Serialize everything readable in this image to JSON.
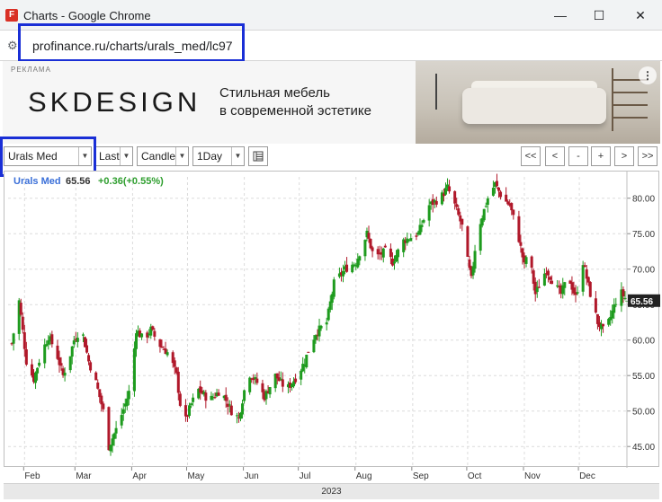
{
  "window": {
    "title": "Charts - Google Chrome",
    "app_icon_letter": "F",
    "minimize": "—",
    "maximize": "☐",
    "close": "✕"
  },
  "address": {
    "site_icon": "⚙",
    "url": "profinance.ru/charts/urals_med/lc97"
  },
  "ad": {
    "label": "РЕКЛАМА",
    "brand": "SKDESIGN",
    "line1": "Стильная мебель",
    "line2": "в современной эстетике",
    "menu_icon": "⋮"
  },
  "toolbar": {
    "symbol": "Urals Med",
    "price_type": "Last",
    "chart_type": "Candle",
    "interval": "1Day",
    "nav": [
      "<<",
      "<",
      "-",
      "+",
      ">",
      ">>"
    ]
  },
  "quote": {
    "name": "Urals Med",
    "last": "65.56",
    "change": "+0.36(+0.55%)"
  },
  "colors": {
    "up": "#1e9b1e",
    "down": "#b0182a",
    "name": "#3a6fd8",
    "change": "#2e9e2e",
    "highlight": "#1a2fd6"
  },
  "chart_data": {
    "type": "candlestick",
    "title": "",
    "ylim": [
      43,
      83
    ],
    "y_ticks": [
      "45.00",
      "50.00",
      "55.00",
      "60.00",
      "65.00",
      "70.00",
      "75.00",
      "80.00"
    ],
    "x_ticks": [
      "Feb",
      "Mar",
      "Apr",
      "May",
      "Jun",
      "Jul",
      "Aug",
      "Sep",
      "Oct",
      "Nov",
      "Dec"
    ],
    "x_tick_days": [
      31,
      59,
      90,
      120,
      151,
      181,
      212,
      243,
      273,
      304,
      334
    ],
    "x_range_days": [
      22,
      360
    ],
    "year_label": "2023",
    "last_price_label": "65.56",
    "anchors": [
      [
        24,
        59.5
      ],
      [
        28,
        65.5
      ],
      [
        32,
        57
      ],
      [
        36,
        54.5
      ],
      [
        40,
        58
      ],
      [
        44,
        60.5
      ],
      [
        48,
        58.5
      ],
      [
        52,
        55
      ],
      [
        56,
        58
      ],
      [
        58,
        60
      ],
      [
        62,
        61.8
      ],
      [
        66,
        57
      ],
      [
        70,
        54
      ],
      [
        75,
        49
      ],
      [
        77,
        45
      ],
      [
        82,
        48
      ],
      [
        86,
        51
      ],
      [
        89,
        53.5
      ],
      [
        92,
        61.5
      ],
      [
        96,
        60
      ],
      [
        100,
        61.5
      ],
      [
        104,
        59.5
      ],
      [
        110,
        58
      ],
      [
        114,
        55
      ],
      [
        116,
        51
      ],
      [
        118,
        48
      ],
      [
        122,
        51
      ],
      [
        126,
        53
      ],
      [
        132,
        51.5
      ],
      [
        138,
        53
      ],
      [
        144,
        50
      ],
      [
        148,
        49
      ],
      [
        153,
        55.5
      ],
      [
        158,
        54
      ],
      [
        162,
        52
      ],
      [
        168,
        55
      ],
      [
        174,
        53
      ],
      [
        180,
        55
      ],
      [
        184,
        57
      ],
      [
        186,
        58.5
      ],
      [
        190,
        61
      ],
      [
        196,
        62.5
      ],
      [
        200,
        68
      ],
      [
        206,
        70
      ],
      [
        212,
        71
      ],
      [
        218,
        75
      ],
      [
        222,
        71.5
      ],
      [
        228,
        72.5
      ],
      [
        232,
        71
      ],
      [
        238,
        74
      ],
      [
        246,
        75
      ],
      [
        252,
        79
      ],
      [
        258,
        80
      ],
      [
        262,
        81.5
      ],
      [
        266,
        79
      ],
      [
        270,
        76
      ],
      [
        272,
        72.5
      ],
      [
        275,
        68.5
      ],
      [
        278,
        75
      ],
      [
        284,
        80
      ],
      [
        288,
        82
      ],
      [
        292,
        80
      ],
      [
        296,
        79
      ],
      [
        300,
        75.5
      ],
      [
        304,
        70.5
      ],
      [
        306,
        73
      ],
      [
        310,
        66.5
      ],
      [
        316,
        70
      ],
      [
        320,
        68
      ],
      [
        324,
        66.5
      ],
      [
        328,
        69
      ],
      [
        332,
        66
      ],
      [
        336,
        71
      ],
      [
        340,
        66.5
      ],
      [
        344,
        62.5
      ],
      [
        348,
        61
      ],
      [
        352,
        64
      ],
      [
        356,
        67
      ],
      [
        360,
        65.56
      ]
    ]
  }
}
